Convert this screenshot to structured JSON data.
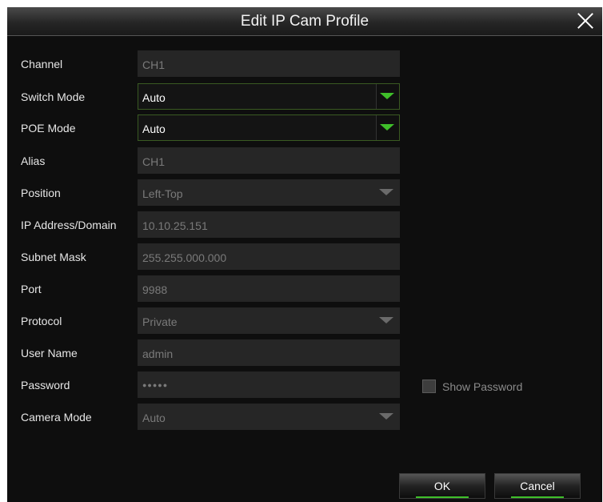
{
  "dialog": {
    "title": "Edit IP Cam Profile"
  },
  "fields": {
    "channel": {
      "label": "Channel",
      "value": "CH1"
    },
    "switch_mode": {
      "label": "Switch Mode",
      "value": "Auto"
    },
    "poe_mode": {
      "label": "POE Mode",
      "value": "Auto"
    },
    "alias": {
      "label": "Alias",
      "value": "CH1"
    },
    "position": {
      "label": "Position",
      "value": "Left-Top"
    },
    "ip_address": {
      "label": "IP Address/Domain",
      "value": "10.10.25.151"
    },
    "subnet_mask": {
      "label": "Subnet Mask",
      "value": "255.255.000.000"
    },
    "port": {
      "label": "Port",
      "value": "9988"
    },
    "protocol": {
      "label": "Protocol",
      "value": "Private"
    },
    "user_name": {
      "label": "User Name",
      "value": "admin"
    },
    "password": {
      "label": "Password",
      "value": "●●●●●"
    },
    "camera_mode": {
      "label": "Camera Mode",
      "value": "Auto"
    }
  },
  "show_password": {
    "label": "Show Password",
    "checked": false
  },
  "buttons": {
    "ok": "OK",
    "cancel": "Cancel"
  },
  "colors": {
    "accent": "#3fbf2a",
    "background": "#0e0e0e"
  },
  "icons": {
    "close": "close-icon",
    "dropdown": "chevron-down-icon"
  }
}
